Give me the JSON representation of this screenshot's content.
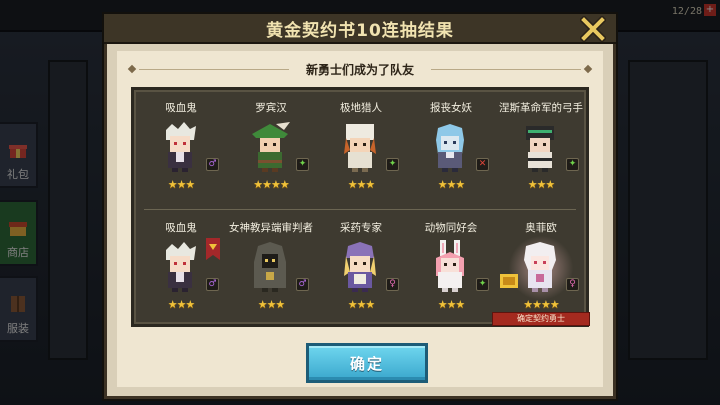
{
  "background": {
    "counter": "12/28",
    "plus": "+",
    "side_buttons": [
      {
        "label": "礼包",
        "icon": "gift-icon"
      },
      {
        "label": "商店",
        "icon": "shop-icon"
      },
      {
        "label": "服装",
        "icon": "wardrobe-icon"
      }
    ]
  },
  "modal": {
    "title": "黄金契约书10连抽结果",
    "subtitle": "新勇士们成为了队友",
    "close_icon": "close-icon",
    "confirm_label": "确定"
  },
  "heroes": [
    {
      "name": "吸血鬼",
      "stars": "★★★",
      "element": "dark",
      "element_color": "#b06ae0"
    },
    {
      "name": "罗宾汉",
      "stars": "★★★★",
      "element": "nature",
      "element_color": "#6fd04a"
    },
    {
      "name": "极地猎人",
      "stars": "★★★",
      "element": "nature",
      "element_color": "#6fd04a"
    },
    {
      "name": "报丧女妖",
      "stars": "★★★",
      "element": "fire",
      "element_color": "#e0463a"
    },
    {
      "name": "涅斯革命军的弓手",
      "stars": "★★★",
      "element": "nature",
      "element_color": "#6fd04a"
    },
    {
      "name": "吸血鬼",
      "stars": "★★★",
      "element": "dark",
      "element_color": "#b06ae0"
    },
    {
      "name": "女神教异端审判者",
      "stars": "★★★",
      "element": "dark",
      "element_color": "#b06ae0"
    },
    {
      "name": "采药专家",
      "stars": "★★★",
      "element": "light",
      "element_color": "#e06ab0"
    },
    {
      "name": "动物同好会",
      "stars": "★★★",
      "element": "nature",
      "element_color": "#6fd04a"
    },
    {
      "name": "奥菲欧",
      "stars": "★★★★",
      "element": "light",
      "element_color": "#e06ab0",
      "badge": "确定契约勇士"
    }
  ]
}
